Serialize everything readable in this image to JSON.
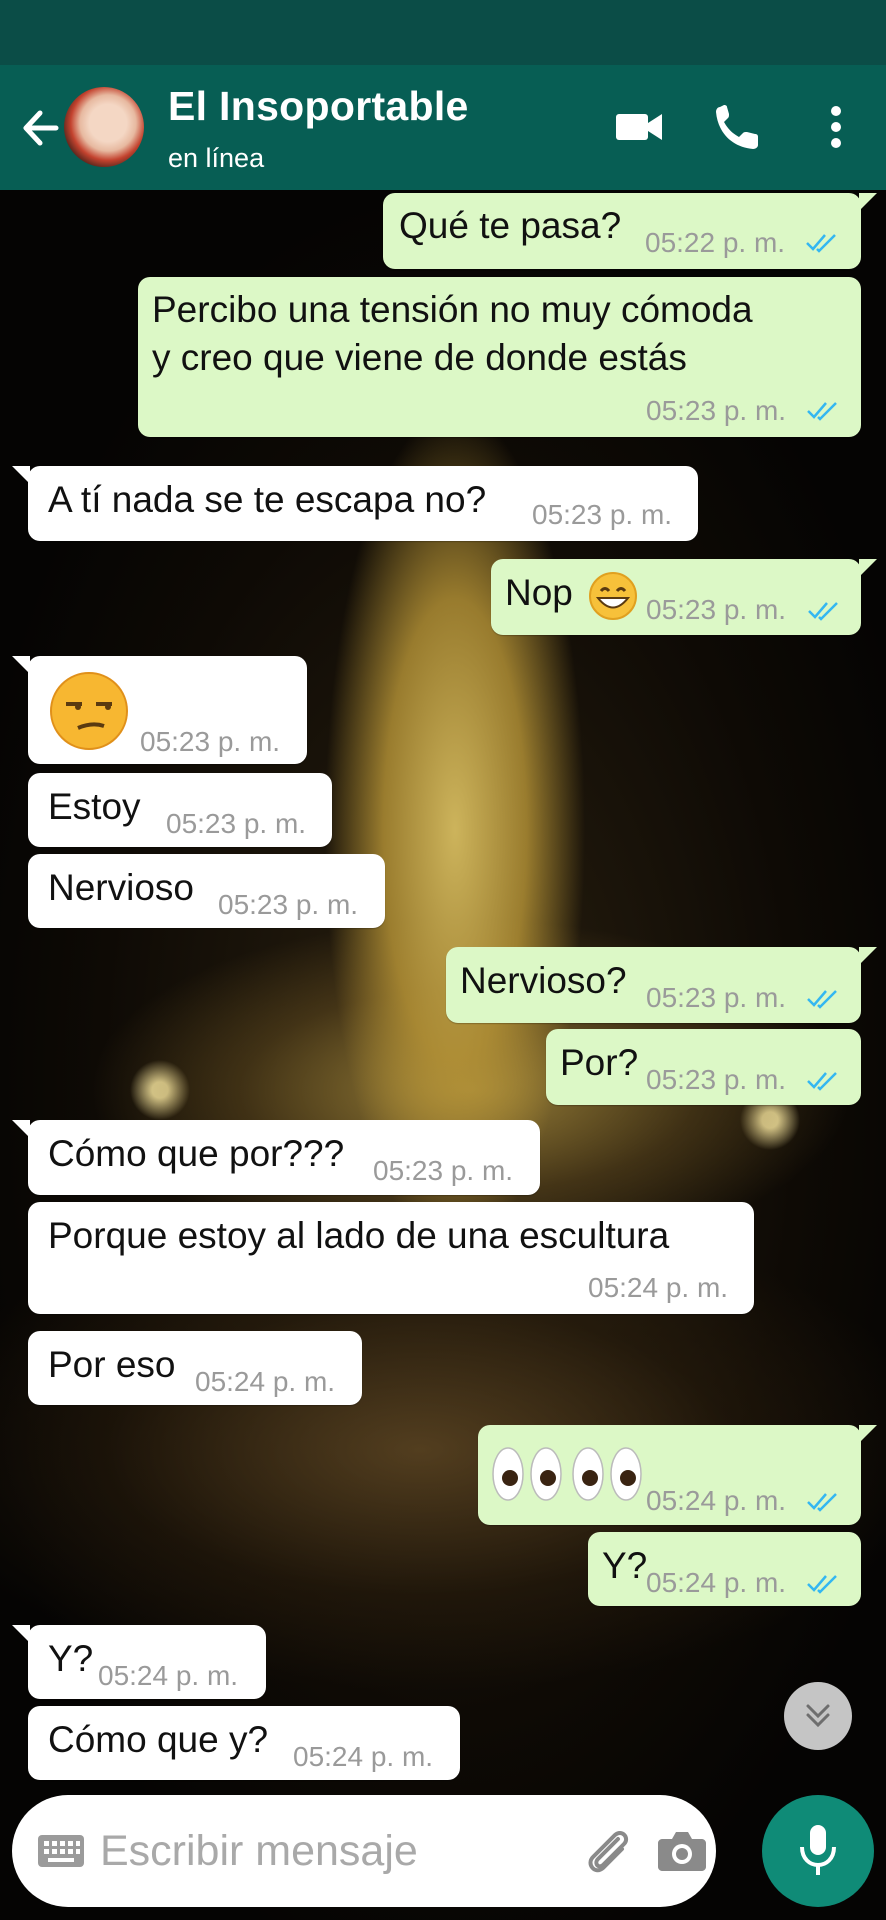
{
  "contact": {
    "name": "El Insoportable",
    "status": "en línea"
  },
  "messages": [
    {
      "text": "Qué te pasa?",
      "time": "05:22 p. m."
    },
    {
      "text1": "Percibo una tensión no muy cómoda",
      "text2": "y creo que viene de donde estás",
      "time": "05:23 p. m."
    },
    {
      "text": "A tí nada se te escapa no?",
      "time": "05:23 p. m."
    },
    {
      "text": "Nop",
      "time": "05:23 p. m."
    },
    {
      "time": "05:23 p. m."
    },
    {
      "text": "Estoy",
      "time": "05:23 p. m."
    },
    {
      "text": "Nervioso",
      "time": "05:23 p. m."
    },
    {
      "text": "Nervioso?",
      "time": "05:23 p. m."
    },
    {
      "text": "Por?",
      "time": "05:23 p. m."
    },
    {
      "text": "Cómo que por???",
      "time": "05:23 p. m."
    },
    {
      "text": "Porque estoy al lado de una escultura",
      "time": "05:24 p. m."
    },
    {
      "text": "Por eso",
      "time": "05:24 p. m."
    },
    {
      "time": "05:24 p. m."
    },
    {
      "text": "Y?",
      "time": "05:24 p. m."
    },
    {
      "text": "Y?",
      "time": "05:24 p. m."
    },
    {
      "text": "Cómo que y?",
      "time": "05:24 p. m."
    }
  ],
  "input": {
    "placeholder": "Escribir mensaje"
  },
  "icons": {
    "back": "arrow-left-icon",
    "video": "video-camera-icon",
    "call": "phone-icon",
    "menu": "kebab-menu-icon",
    "keyboard": "keyboard-icon",
    "attach": "paperclip-icon",
    "camera": "camera-icon",
    "mic": "microphone-icon",
    "scroll": "chevron-double-down-icon",
    "read_receipt": "double-check-icon"
  },
  "colors": {
    "header": "#075e54",
    "statusbar": "#0b4d47",
    "outgoing": "#dcf8c6",
    "incoming": "#ffffff",
    "tick": "#34b7f1",
    "fab": "#0f8b77"
  }
}
